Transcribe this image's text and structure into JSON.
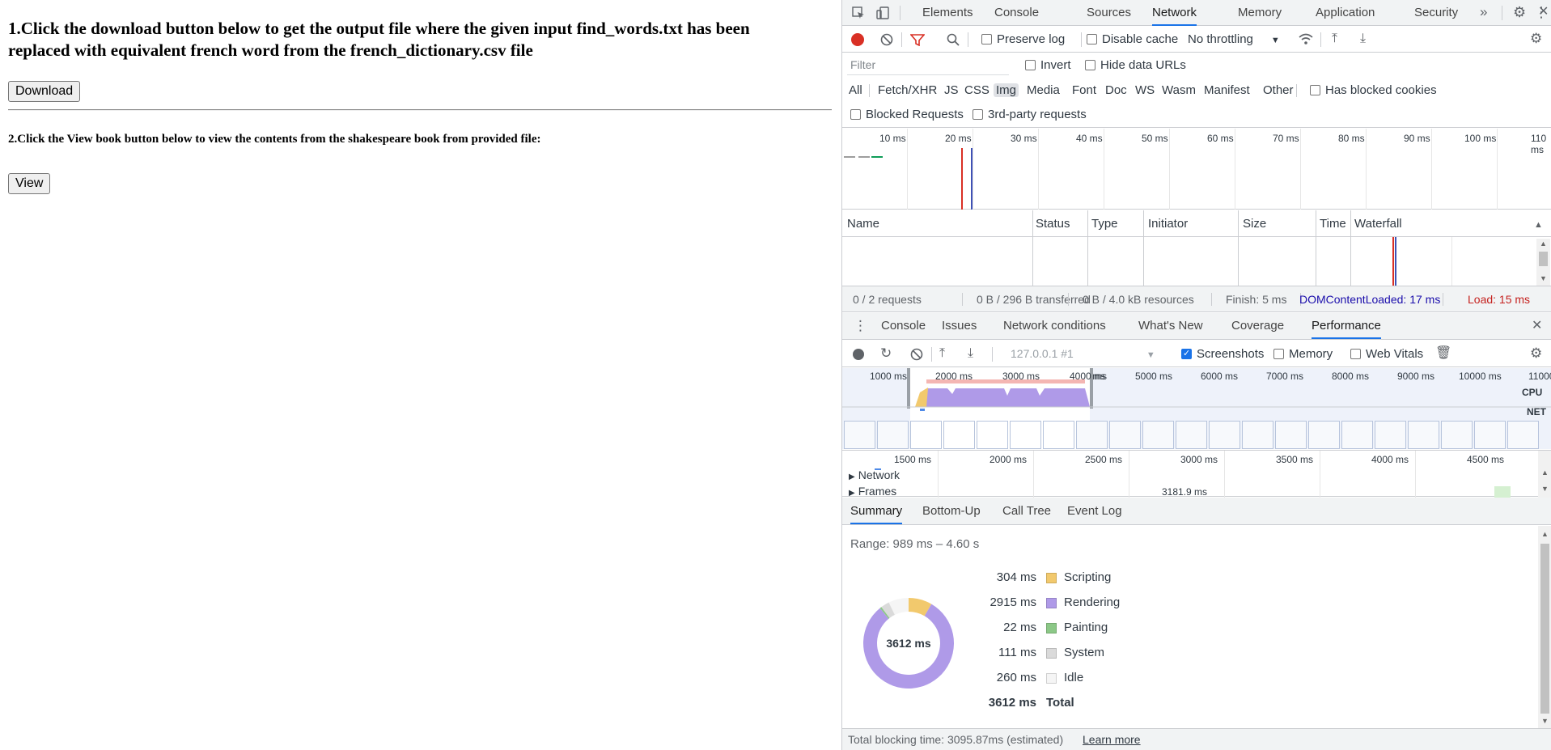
{
  "page": {
    "heading1": "1.Click the download button below to get the output file where the given input find_words.txt has been replaced with equivalent french word from the french_dictionary.csv file",
    "download_label": "Download",
    "heading2": "2.Click the View book button below to view the contents from the shakespeare book from provided file:",
    "view_label": "View"
  },
  "devtools": {
    "tabs": [
      "Elements",
      "Console",
      "Sources",
      "Network",
      "Memory",
      "Application",
      "Security"
    ],
    "active_tab": "Network",
    "more_tabs_icon": "chevron-double-right-icon",
    "network": {
      "preserve_log": "Preserve log",
      "disable_cache": "Disable cache",
      "throttling": "No throttling",
      "filter_placeholder": "Filter",
      "invert": "Invert",
      "hide_data_urls": "Hide data URLs",
      "types": [
        "All",
        "Fetch/XHR",
        "JS",
        "CSS",
        "Img",
        "Media",
        "Font",
        "Doc",
        "WS",
        "Wasm",
        "Manifest",
        "Other"
      ],
      "selected_type": "Img",
      "has_blocked_cookies": "Has blocked cookies",
      "blocked_requests": "Blocked Requests",
      "third_party": "3rd-party requests",
      "overview_ticks": [
        "10 ms",
        "20 ms",
        "30 ms",
        "40 ms",
        "50 ms",
        "60 ms",
        "70 ms",
        "80 ms",
        "90 ms",
        "100 ms",
        "110 ms"
      ],
      "columns": [
        "Name",
        "Status",
        "Type",
        "Initiator",
        "Size",
        "Time",
        "Waterfall"
      ],
      "status": {
        "requests": "0 / 2 requests",
        "transferred": "0 B / 296 B transferred",
        "resources": "0 B / 4.0 kB resources",
        "finish": "Finish: 5 ms",
        "dcl": "DOMContentLoaded: 17 ms",
        "load": "Load: 15 ms"
      }
    },
    "drawer": {
      "tabs": [
        "Console",
        "Issues",
        "Network conditions",
        "What's New",
        "Coverage",
        "Performance"
      ],
      "active_tab": "Performance",
      "perf": {
        "target": "127.0.0.1 #1",
        "screenshots": "Screenshots",
        "memory": "Memory",
        "web_vitals": "Web Vitals",
        "overview_ticks": [
          "1000 ms",
          "2000 ms",
          "3000 ms",
          "4000 ms",
          "5000 ms",
          "6000 ms",
          "7000 ms",
          "8000 ms",
          "9000 ms",
          "10000 ms",
          "11000"
        ],
        "cpu_label": "CPU",
        "net_label": "NET",
        "main_ticks": [
          "1500 ms",
          "2000 ms",
          "2500 ms",
          "3000 ms",
          "3500 ms",
          "4000 ms",
          "4500 ms"
        ],
        "tracks": [
          "Network",
          "Frames"
        ],
        "frame_time": "3181.9 ms",
        "summary_tabs": [
          "Summary",
          "Bottom-Up",
          "Call Tree",
          "Event Log"
        ],
        "active_summary_tab": "Summary",
        "range": "Range: 989 ms – 4.60 s",
        "total_center": "3612 ms",
        "legend": [
          {
            "value": "304 ms",
            "name": "Scripting",
            "color": "#f2c96d"
          },
          {
            "value": "2915 ms",
            "name": "Rendering",
            "color": "#af9ae8"
          },
          {
            "value": "22 ms",
            "name": "Painting",
            "color": "#8cc887"
          },
          {
            "value": "111 ms",
            "name": "System",
            "color": "#dadada"
          },
          {
            "value": "260 ms",
            "name": "Idle",
            "color": "#f5f5f5"
          }
        ],
        "total_value": "3612 ms",
        "total_label": "Total",
        "blocking": "Total blocking time: 3095.87ms (estimated)",
        "learn_more": "Learn more"
      }
    }
  }
}
